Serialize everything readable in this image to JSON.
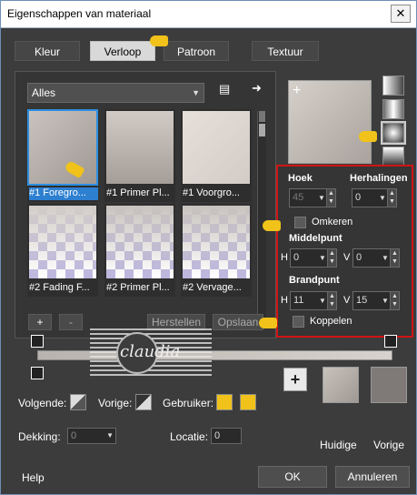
{
  "window": {
    "title": "Eigenschappen van materiaal",
    "close_label": "✕"
  },
  "tabs": [
    {
      "label": "Kleur",
      "active": false
    },
    {
      "label": "Verloop",
      "active": true
    },
    {
      "label": "Patroon",
      "active": false
    },
    {
      "label": "Textuur",
      "active": false
    }
  ],
  "library": {
    "category_value": "Alles",
    "items": [
      {
        "label": "#1 Foregro...",
        "selected": true,
        "style": "fg-bg"
      },
      {
        "label": "#1 Primer Pl...",
        "selected": false,
        "style": "primer"
      },
      {
        "label": "#1 Voorgro...",
        "selected": false,
        "style": "voorgrond"
      },
      {
        "label": "#2 Fading F...",
        "selected": false,
        "style": "fading"
      },
      {
        "label": "#2 Primer Pl...",
        "selected": false,
        "style": "fading"
      },
      {
        "label": "#2 Vervage...",
        "selected": false,
        "style": "fading"
      }
    ],
    "add_label": "+",
    "remove_label": "-",
    "herstellen_label": "Herstellen",
    "opslaan_label": "Opslaan"
  },
  "settings": {
    "hoek_label": "Hoek",
    "hoek_value": "45",
    "herhalingen_label": "Herhalingen",
    "herhalingen_value": "0",
    "omkeren_label": "Omkeren",
    "omkeren_checked": false,
    "middelpunt_label": "Middelpunt",
    "middelpunt_h_label": "H",
    "middelpunt_h": "0",
    "middelpunt_v_label": "V",
    "middelpunt_v": "0",
    "brandpunt_label": "Brandpunt",
    "brandpunt_h_label": "H",
    "brandpunt_h": "11",
    "brandpunt_v_label": "V",
    "brandpunt_v": "15",
    "koppelen_label": "Koppelen",
    "koppelen_checked": false
  },
  "bottom": {
    "volgende_label": "Volgende:",
    "vorige_label": "Vorige:",
    "gebruiker_label": "Gebruiker:",
    "dekking_label": "Dekking:",
    "dekking_value": "0",
    "locatie_label": "Locatie:",
    "locatie_value": "0",
    "huidige_label": "Huidige",
    "vorige_swatch_label": "Vorige",
    "help_label": "Help",
    "ok_label": "OK",
    "annuleren_label": "Annuleren"
  },
  "logo": {
    "text": "claudia"
  },
  "colors": {
    "accent_selected": "#2d7fd0",
    "highlight_border": "#d01414",
    "user_color": "#f0c21a",
    "gradient_start": "#a9a29d",
    "gradient_end": "#d6d0ca",
    "current_swatch": "#a8a19c",
    "previous_swatch": "#7f7a77"
  }
}
